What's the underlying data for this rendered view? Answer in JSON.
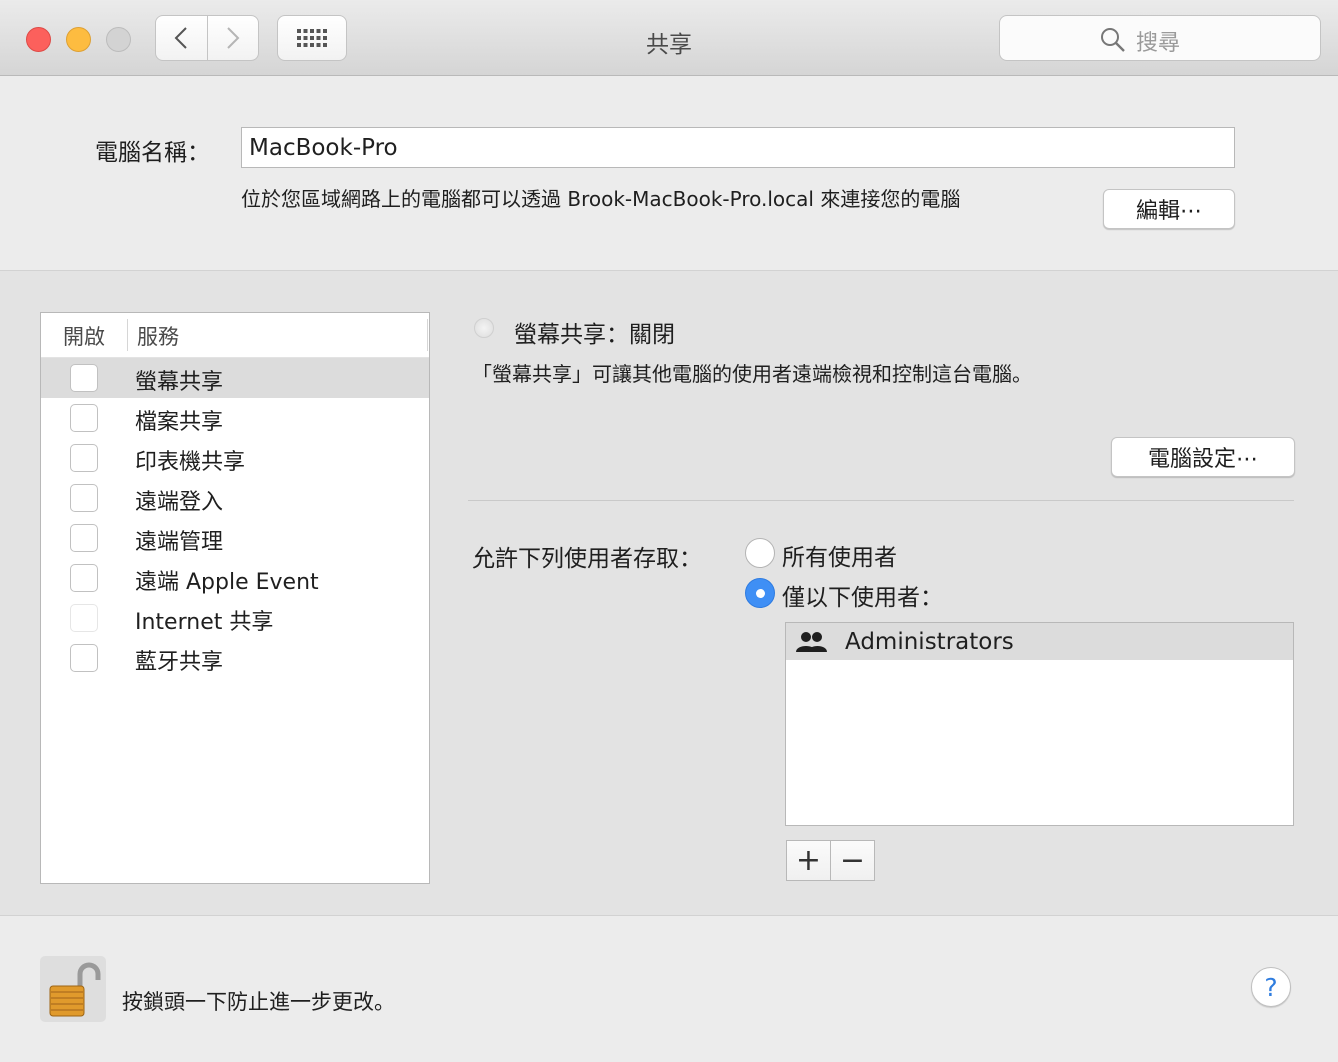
{
  "window": {
    "title": "共享",
    "search_placeholder": "搜尋"
  },
  "computer_name": {
    "label": "電腦名稱：",
    "value": "MacBook-Pro",
    "description": "位於您區域網路上的電腦都可以透過 Brook-MacBook-Pro.local 來連接您的電腦",
    "edit_button": "編輯⋯"
  },
  "services": {
    "header_on": "開啟",
    "header_service": "服務",
    "items": [
      {
        "label": "螢幕共享",
        "checked": false,
        "selected": true
      },
      {
        "label": "檔案共享",
        "checked": false
      },
      {
        "label": "印表機共享",
        "checked": false
      },
      {
        "label": "遠端登入",
        "checked": false
      },
      {
        "label": "遠端管理",
        "checked": false
      },
      {
        "label": "遠端 Apple Event",
        "checked": false
      },
      {
        "label": "Internet 共享",
        "checked": false,
        "disabled": true
      },
      {
        "label": "藍牙共享",
        "checked": false
      }
    ]
  },
  "detail": {
    "status": "螢幕共享：關閉",
    "description": "「螢幕共享」可讓其他電腦的使用者遠端檢視和控制這台電腦。",
    "settings_button": "電腦設定⋯",
    "allow_label": "允許下列使用者存取：",
    "option_all": "所有使用者",
    "option_only": "僅以下使用者：",
    "selected_option": "only",
    "users": [
      "Administrators"
    ],
    "add_label": "+",
    "remove_label": "−"
  },
  "footer": {
    "lock_text": "按鎖頭一下防止進一步更改。",
    "help_label": "?"
  },
  "colors": {
    "close": "#fc605c",
    "minimize": "#fdbc40",
    "accent": "#3f8ff5",
    "lock": "#e09a2c"
  },
  "icons": [
    "back-chevron-icon",
    "forward-chevron-icon",
    "grid-icon",
    "search-icon",
    "group-users-icon",
    "unlocked-padlock-icon"
  ]
}
